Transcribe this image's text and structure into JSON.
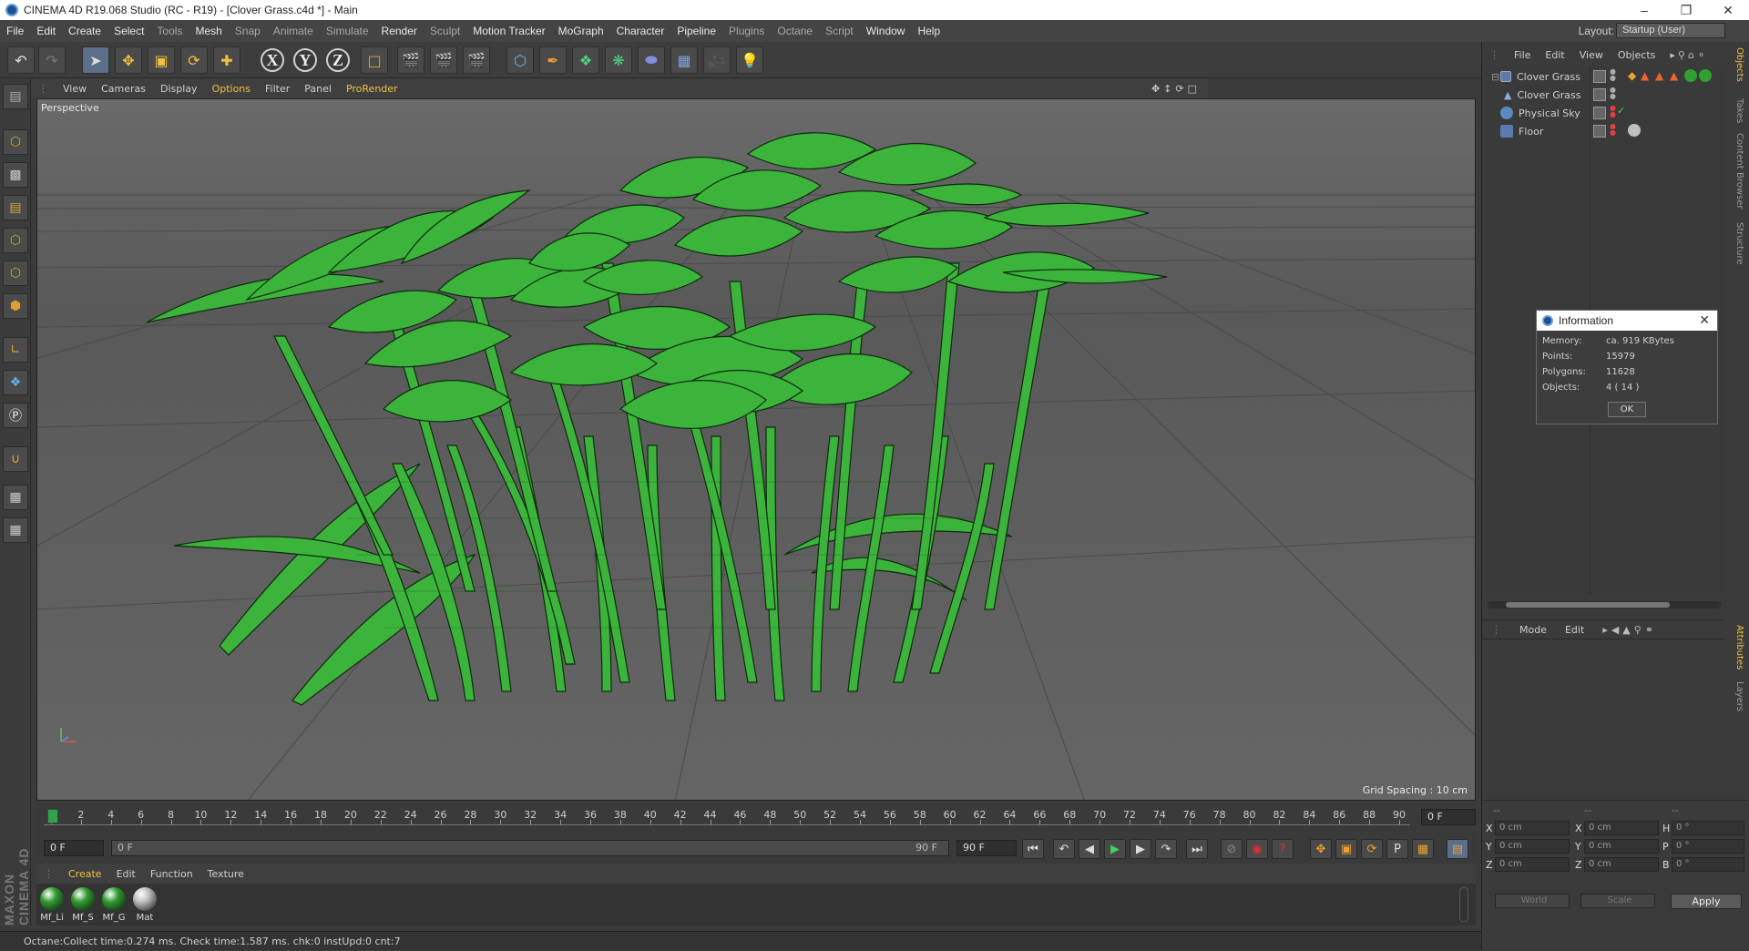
{
  "window": {
    "title": "CINEMA 4D R19.068 Studio (RC - R19) - [Clover Grass.c4d *] - Main"
  },
  "menubar": {
    "items": [
      "File",
      "Edit",
      "Create",
      "Select",
      "Tools",
      "Mesh",
      "Snap",
      "Animate",
      "Simulate",
      "Render",
      "Sculpt",
      "Motion Tracker",
      "MoGraph",
      "Character",
      "Pipeline",
      "Plugins",
      "Octane",
      "Script",
      "Window",
      "Help"
    ],
    "layout_label": "Layout:",
    "layout_value": "Startup (User)"
  },
  "toolbar": {
    "axis_x": "X",
    "axis_y": "Y",
    "axis_z": "Z"
  },
  "viewport": {
    "menu": [
      "View",
      "Cameras",
      "Display",
      "Options",
      "Filter",
      "Panel",
      "ProRender"
    ],
    "label": "Perspective",
    "grid_spacing": "Grid Spacing : 10 cm"
  },
  "timeline": {
    "ticks": [
      "0",
      "2",
      "4",
      "6",
      "8",
      "10",
      "12",
      "14",
      "16",
      "18",
      "20",
      "22",
      "24",
      "26",
      "28",
      "30",
      "32",
      "34",
      "36",
      "38",
      "40",
      "42",
      "44",
      "46",
      "48",
      "50",
      "52",
      "54",
      "56",
      "58",
      "60",
      "62",
      "64",
      "66",
      "68",
      "70",
      "72",
      "74",
      "76",
      "78",
      "80",
      "82",
      "84",
      "86",
      "88",
      "90"
    ],
    "current_frame_right": "0 F"
  },
  "transport": {
    "start_field": "0 F",
    "range_start": "0 F",
    "range_end": "90 F",
    "end_field": "90 F"
  },
  "material_manager": {
    "menu": [
      "Create",
      "Edit",
      "Function",
      "Texture"
    ],
    "materials": [
      {
        "label": "Mf_Li",
        "color": "#2f9a2f"
      },
      {
        "label": "Mf_S",
        "color": "#2f9a2f"
      },
      {
        "label": "Mf_G",
        "color": "#2f9a2f"
      },
      {
        "label": "Mat",
        "color": "#bdbdbd"
      }
    ]
  },
  "brand": "MAXON CINEMA 4D",
  "status": "Octane:Collect time:0.274 ms.  Check time:1.587 ms.  chk:0  instUpd:0  cnt:7",
  "object_manager": {
    "menu": [
      "File",
      "Edit",
      "View",
      "Objects"
    ],
    "objects": [
      "Clover Grass",
      "Clover Grass",
      "Physical Sky",
      "Floor"
    ]
  },
  "attributes": {
    "menu": [
      "Mode",
      "Edit"
    ]
  },
  "side_tabs": [
    "Objects",
    "Takes",
    "Content Browser",
    "Structure",
    "Attributes",
    "Layers"
  ],
  "coordinates": {
    "headers": [
      "--",
      "--",
      "--"
    ],
    "rows": [
      {
        "a": "X",
        "av": "0 cm",
        "b": "X",
        "bv": "0 cm",
        "c": "H",
        "cv": "0 °"
      },
      {
        "a": "Y",
        "av": "0 cm",
        "b": "Y",
        "bv": "0 cm",
        "c": "P",
        "cv": "0 °"
      },
      {
        "a": "Z",
        "av": "0 cm",
        "b": "Z",
        "bv": "0 cm",
        "c": "B",
        "cv": "0 °"
      }
    ],
    "world": "World",
    "scale": "Scale",
    "apply": "Apply"
  },
  "info_dialog": {
    "title": "Information",
    "memory_label": "Memory:",
    "memory": "ca. 919 KBytes",
    "points_label": "Points:",
    "points": "15979",
    "polygons_label": "Polygons:",
    "polygons": "11628",
    "objects_label": "Objects:",
    "objects": "4 ( 14 )",
    "ok": "OK"
  }
}
